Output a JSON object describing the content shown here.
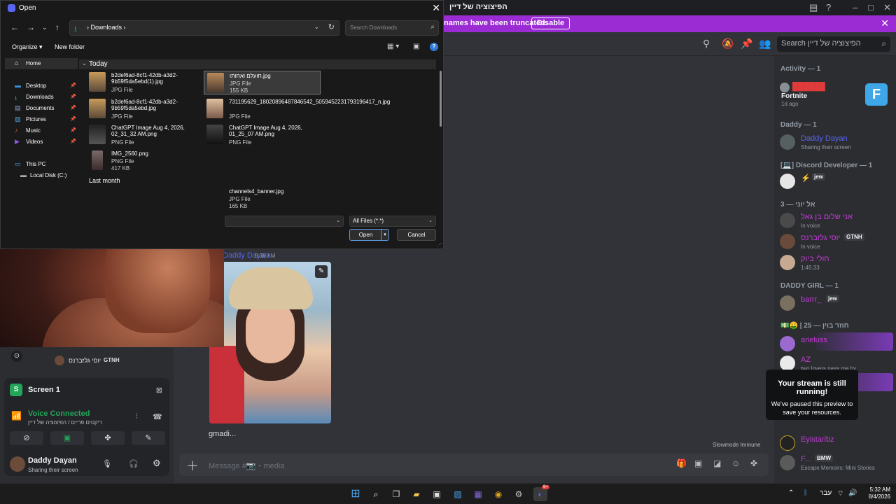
{
  "discord": {
    "server_title": "הפיצוציה של דיין",
    "notice": {
      "text": "names have been truncated.",
      "button": "Disable"
    },
    "search_placeholder": "Search הפיצוציה של דיין",
    "member_list": {
      "activity_heading": "Activity — 1",
      "activity_game": "Fortnite",
      "activity_time": "1d ago",
      "groups": [
        {
          "heading": "Daddy — 1"
        },
        {
          "heading": "[💻] Discord Developer — 1"
        },
        {
          "heading": "אל יוני — 3"
        },
        {
          "heading": "DADDY GIRL — 1"
        },
        {
          "heading": "💵🤑 | חוזר בוין — 25"
        }
      ],
      "members": [
        {
          "name": "Daddy Dayan",
          "status": "Sharing their screen",
          "color": "#5865f2"
        },
        {
          "name": "⚡",
          "tag": "jew",
          "color": "#c23bd6"
        },
        {
          "name": "אני שלום בן גאל",
          "status": "In voice",
          "color": "#c23bd6"
        },
        {
          "name": "יוסי גלזברנס",
          "tag": "GTNH",
          "status": "In voice",
          "color": "#c23bd6"
        },
        {
          "name": "חולי ביוק",
          "status": "1:45:33",
          "color": "#c23bd6"
        },
        {
          "name": "barrr_",
          "tag": "jew",
          "color": "#c23bd6"
        },
        {
          "name": "arieluss",
          "color": "#c23bd6"
        },
        {
          "name": "AZ",
          "status": "two lovers pass me by",
          "color": "#c23bd6"
        },
        {
          "name": "Eyistaribz",
          "color": "#c23bd6"
        },
        {
          "name": "F...",
          "tag": "BMW",
          "status": "Escape Memoirs: Mini Stories",
          "color": "#c23bd6"
        }
      ]
    },
    "tooltip": {
      "title": "Your stream is still running!",
      "body": "We've paused this preview to save your resources."
    },
    "chat": {
      "author": "Daddy Dayan",
      "time": "5:36 AM",
      "caption": "gmadi...",
      "slowmode": "Slowmode Immune",
      "composer_placeholder": "Message #📷・media"
    },
    "voice_users": [
      "יוסי גלזברנס",
      "GTNH"
    ],
    "screen_share": {
      "title": "Screen 1",
      "voice_status": "Voice Connected",
      "voice_channel": "ריקטים פריים / הפיצוציה של דיין",
      "user_name": "Daddy Dayan",
      "user_status": "Sharing their screen"
    }
  },
  "dialog": {
    "title": "Open",
    "breadcrumb": "Downloads",
    "search_placeholder": "Search Downloads",
    "organize": "Organize",
    "new_folder": "New folder",
    "nav_items": [
      {
        "label": "Home",
        "icon": "home-icon"
      },
      {
        "label": "Desktop",
        "icon": "desktop-icon"
      },
      {
        "label": "Downloads",
        "icon": "download-icon"
      },
      {
        "label": "Documents",
        "icon": "documents-icon"
      },
      {
        "label": "Pictures",
        "icon": "pictures-icon"
      },
      {
        "label": "Music",
        "icon": "music-icon"
      },
      {
        "label": "Videos",
        "icon": "videos-icon"
      },
      {
        "label": "This PC",
        "icon": "pc-icon"
      },
      {
        "label": "Local Disk (C:)",
        "icon": "disk-icon"
      }
    ],
    "group_today": "Today",
    "group_last": "Last month",
    "files": [
      {
        "name": "b2def6ad-8cf1-42db-a3d2-9b59f5da5ebd(1).jpg",
        "type": "JPG File",
        "size": ""
      },
      {
        "name": "חועלם ואחותו.jpg",
        "type": "JPG File",
        "size": "155 KB"
      },
      {
        "name": "b2def6ad-8cf1-42db-a3d2-9b59f5da5ebd.jpg",
        "type": "JPG File",
        "size": ""
      },
      {
        "name": "731195629_18020896487846542_5059452231793196417_n.jpg",
        "type": "JPG File",
        "size": ""
      },
      {
        "name": "ChatGPT Image Aug 4, 2026, 02_31_32 AM.png",
        "type": "PNG File",
        "size": ""
      },
      {
        "name": "ChatGPT Image Aug 4, 2026, 01_25_07 AM.png",
        "type": "PNG File",
        "size": ""
      },
      {
        "name": "IMG_2560.png",
        "type": "PNG File",
        "size": "417 KB"
      },
      {
        "name": "channels4_banner.jpg",
        "type": "JPG File",
        "size": "165 KB"
      }
    ],
    "file_type": "All Files (*.*)",
    "open": "Open",
    "cancel": "Cancel"
  },
  "taskbar": {
    "lang": "עבר",
    "time": "5:32 AM",
    "date": "8/4/2026",
    "badge": "9+"
  }
}
